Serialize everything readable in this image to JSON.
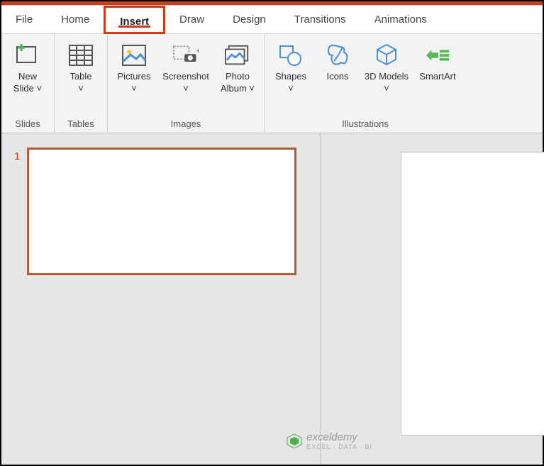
{
  "tabs": {
    "file": "File",
    "home": "Home",
    "insert": "Insert",
    "draw": "Draw",
    "design": "Design",
    "transitions": "Transitions",
    "animations": "Animations"
  },
  "ribbon": {
    "slides": {
      "label": "Slides",
      "newSlide": "New Slide"
    },
    "tables": {
      "label": "Tables",
      "table": "Table"
    },
    "images": {
      "label": "Images",
      "pictures": "Pictures",
      "screenshot": "Screenshot",
      "photoAlbum": "Photo Album"
    },
    "illustrations": {
      "label": "Illustrations",
      "shapes": "Shapes",
      "icons": "Icons",
      "models3d": "3D Models",
      "smartart": "SmartArt"
    }
  },
  "thumbs": {
    "slide1": "1"
  },
  "watermark": {
    "name": "exceldemy",
    "tag": "EXCEL · DATA · BI"
  }
}
